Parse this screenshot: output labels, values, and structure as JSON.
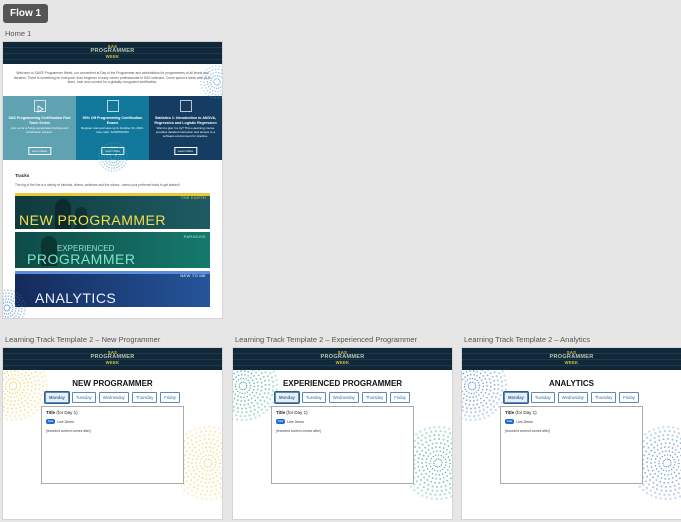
{
  "flow": {
    "label": "Flow 1"
  },
  "home": {
    "label": "Home 1",
    "logo": {
      "top": "SAS",
      "mid": "PROGRAMMER",
      "bottom": "WEEK"
    },
    "intro": "Welcome to SAS® Programmer Week, our convenient at Day of the Programmer and celebrations for programmers of all levels and libraries. There is something for everyone, from beginner to early career professionals to SAS veterans. Come spend a week with us to learn, train and connect for a globally recognized certification.",
    "panels": [
      {
        "title": "SAS Programming Certification Fast Track Series",
        "body": "Join us for a 5-day accelerated training and certification session.",
        "button": "Learn More",
        "color": "#5fa3b2"
      },
      {
        "title": "50% Off Programming Certification Exams",
        "body": "Register now and save up to October 31, 2021. Use code: SASPROG50",
        "button": "Learn More",
        "color": "#12789b"
      },
      {
        "title": "Statistics 1: Introduction to ANOVA, Regression and Logistic Regression",
        "body": "Want to give it a try? This e-learning course provides detailed instruction and access to a software environment for practice.",
        "button": "Learn More",
        "color": "#143d61"
      }
    ],
    "tracks_heading": "Tracks",
    "tracks_text": "The big of the line is a variety of tutorials, videos, webinars and live shows - select your preferred track to get started!",
    "track_banners": [
      {
        "big": "NEW PROGRAMMER",
        "small": "THE EARTH"
      },
      {
        "line1": "EXPERIENCED",
        "big": "PROGRAMMER",
        "small": "PARADISE"
      },
      {
        "big": "ANALYTICS",
        "small": "NEW TO ME"
      }
    ]
  },
  "templates": [
    {
      "label": "Learning Track Template 2 – New Programmer",
      "title": "NEW PROGRAMMER",
      "accent": "#f0c330"
    },
    {
      "label": "Learning Track Template 2 – Experienced Programmer",
      "title": "EXPERIENCED PROGRAMMER",
      "accent": "#1f9a7f"
    },
    {
      "label": "Learning Track Template 2 – Analytics",
      "title": "ANALYTICS",
      "accent": "#3a78c4"
    }
  ],
  "days": [
    "Monday",
    "Tuesday",
    "Wednesday",
    "Thursday",
    "Friday"
  ],
  "active_day": "Monday",
  "card": {
    "title_bold": "Title",
    "title_rest": " (for Day 1)",
    "badge": "Live",
    "live_label": "Live Demo",
    "recorded": "[recorded content comes after]"
  }
}
